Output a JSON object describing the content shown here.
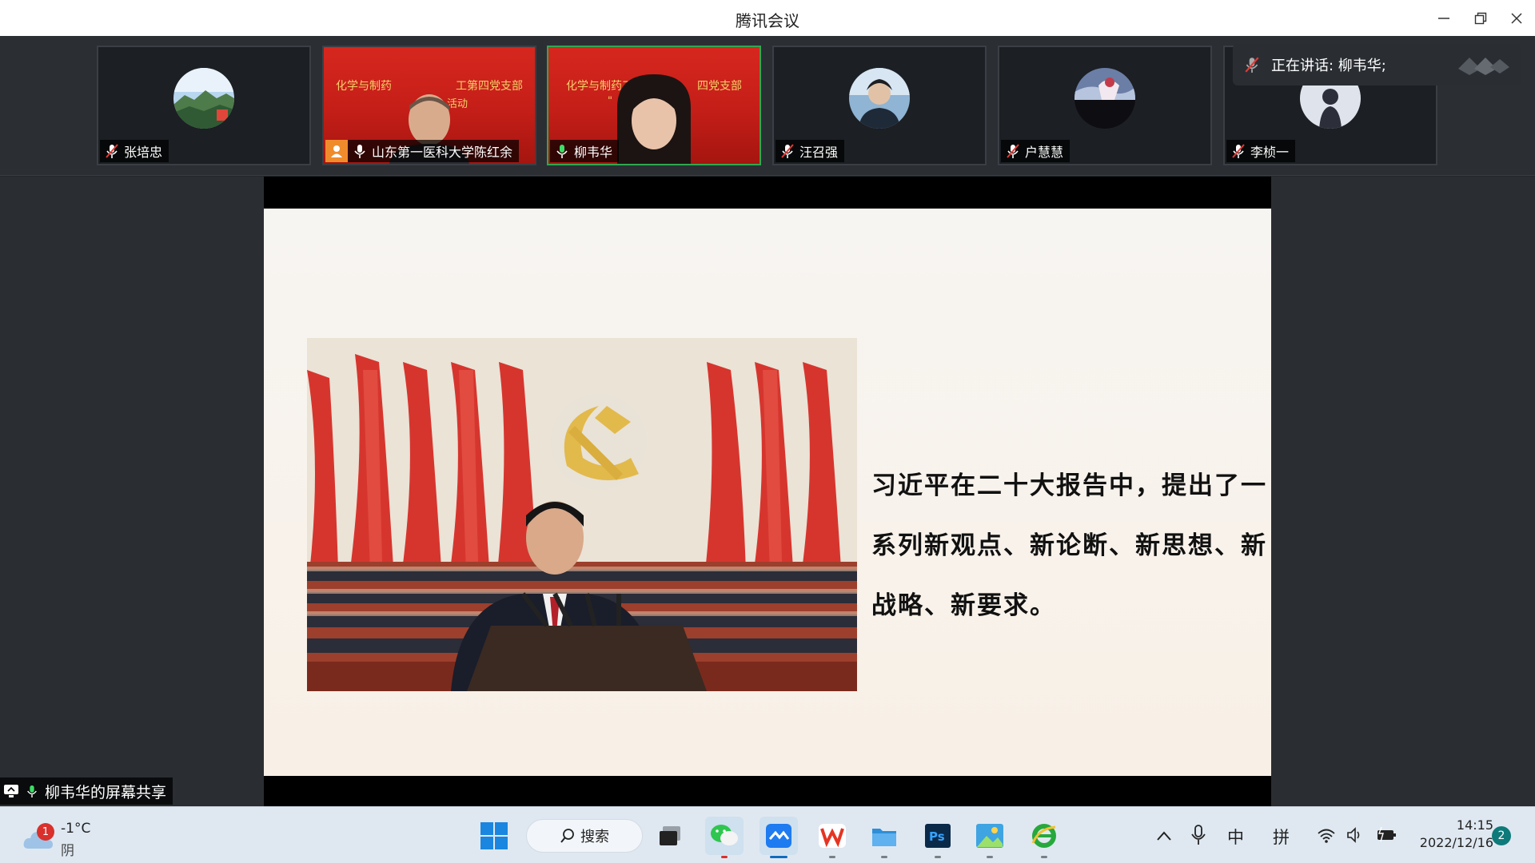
{
  "window": {
    "title": "腾讯会议",
    "minimize_icon": "minimize-icon",
    "restore_icon": "restore-icon",
    "close_icon": "close-icon"
  },
  "participants": [
    {
      "name": "张培忠",
      "mic": "muted",
      "avatar": "mountain-landscape"
    },
    {
      "name": "山东第一医科大学陈红余",
      "mic": "on",
      "video": true,
      "host_icon": true
    },
    {
      "name": "柳韦华",
      "mic": "on",
      "video": true,
      "speaking": true
    },
    {
      "name": "汪召强",
      "mic": "muted",
      "avatar": "person-photo"
    },
    {
      "name": "户慧慧",
      "mic": "muted",
      "avatar": "anime-figure"
    },
    {
      "name": "李桢一",
      "mic": "muted",
      "avatar": "person-silhouette"
    }
  ],
  "video_banner": {
    "line1_left": "化学与制药",
    "line1_right": "工第四党支部",
    "line2": "活动",
    "line1_left_b": "化学与制药工",
    "line1_right_b": "四党支部",
    "line2_b": "\""
  },
  "speaking_indicator": {
    "label": "正在讲话: 柳韦华;"
  },
  "slide": {
    "text": "习近平在二十大报告中，提出了一系列新观点、新论断、新思想、新战略、新要求。",
    "image": "party-congress-photo"
  },
  "share_label": {
    "text": "柳韦华的屏幕共享"
  },
  "taskbar": {
    "weather": {
      "temp": "-1°C",
      "condition": "阴",
      "badge": "1"
    },
    "search_label": "搜索",
    "apps": [
      "windows-start",
      "task-view",
      "wechat",
      "tencent-meeting",
      "wps",
      "file-explorer",
      "photoshop",
      "photos",
      "ie-browser"
    ],
    "tray": {
      "ime_lang": "中",
      "ime_mode": "拼"
    },
    "clock": {
      "time": "14:15",
      "date": "2022/12/16"
    },
    "notifications": "2"
  }
}
